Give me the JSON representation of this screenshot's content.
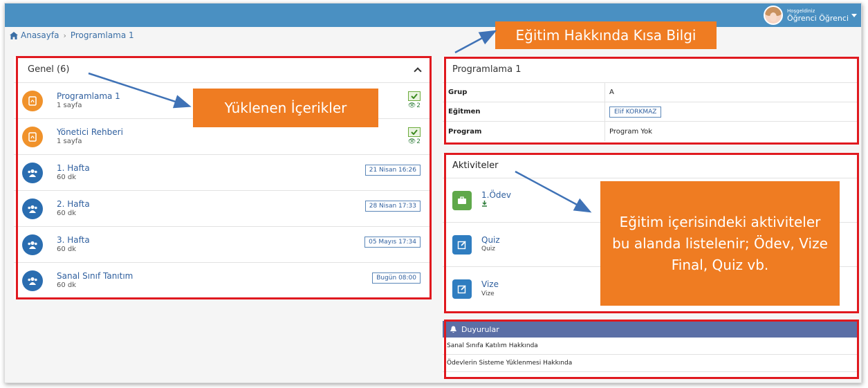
{
  "header": {
    "greeting": "Hoşgeldiniz",
    "user_name": "Öğrenci Öğrenci"
  },
  "breadcrumb": {
    "home": "Anasayfa",
    "current": "Programlama 1"
  },
  "contents": {
    "title": "Genel (6)",
    "items": [
      {
        "title": "Programlama 1",
        "sub": "1 sayfa",
        "views": "2",
        "icon": "pdf-icon"
      },
      {
        "title": "Yönetici Rehberi",
        "sub": "1 sayfa",
        "views": "2",
        "icon": "pdf-icon"
      },
      {
        "title": "1. Hafta",
        "sub": "60 dk",
        "date": "21 Nisan 16:26",
        "icon": "users-icon"
      },
      {
        "title": "2. Hafta",
        "sub": "60 dk",
        "date": "28 Nisan 17:33",
        "icon": "users-icon"
      },
      {
        "title": "3. Hafta",
        "sub": "60 dk",
        "date": "05 Mayıs 17:34",
        "icon": "users-icon"
      },
      {
        "title": "Sanal Sınıf Tanıtım",
        "sub": "60 dk",
        "date": "Bugün 08:00",
        "icon": "users-icon"
      }
    ]
  },
  "course_info": {
    "title": "Programlama 1",
    "rows": [
      {
        "label": "Grup",
        "value": "A"
      },
      {
        "label": "Eğitmen",
        "value": "Elif KORKMAZ"
      },
      {
        "label": "Program",
        "value": "Program Yok"
      }
    ]
  },
  "activities": {
    "title": "Aktiviteler",
    "items": [
      {
        "title": "1.Ödev",
        "sub": "",
        "icon": "briefcase-icon"
      },
      {
        "title": "Quiz",
        "sub": "Quiz",
        "icon": "edit-icon"
      },
      {
        "title": "Vize",
        "sub": "Vize",
        "icon": "edit-icon"
      }
    ]
  },
  "announcements": {
    "title": "Duyurular",
    "items": [
      "Sanal Sınıfa Katılım Hakkında",
      "Ödevlerin Sisteme Yüklenmesi Hakkında"
    ]
  },
  "callouts": {
    "uploaded": "Yüklenen İçerikler",
    "info": "Eğitim Hakkında Kısa Bilgi",
    "activities": "Eğitim içerisindeki aktiviteler bu alanda listelenir; Ödev, Vize Final, Quiz vb."
  },
  "colors": {
    "topbar": "#4a90c2",
    "highlight": "#e0191f",
    "callout": "#ef7c22",
    "announcement_header": "#5b6fa6"
  }
}
